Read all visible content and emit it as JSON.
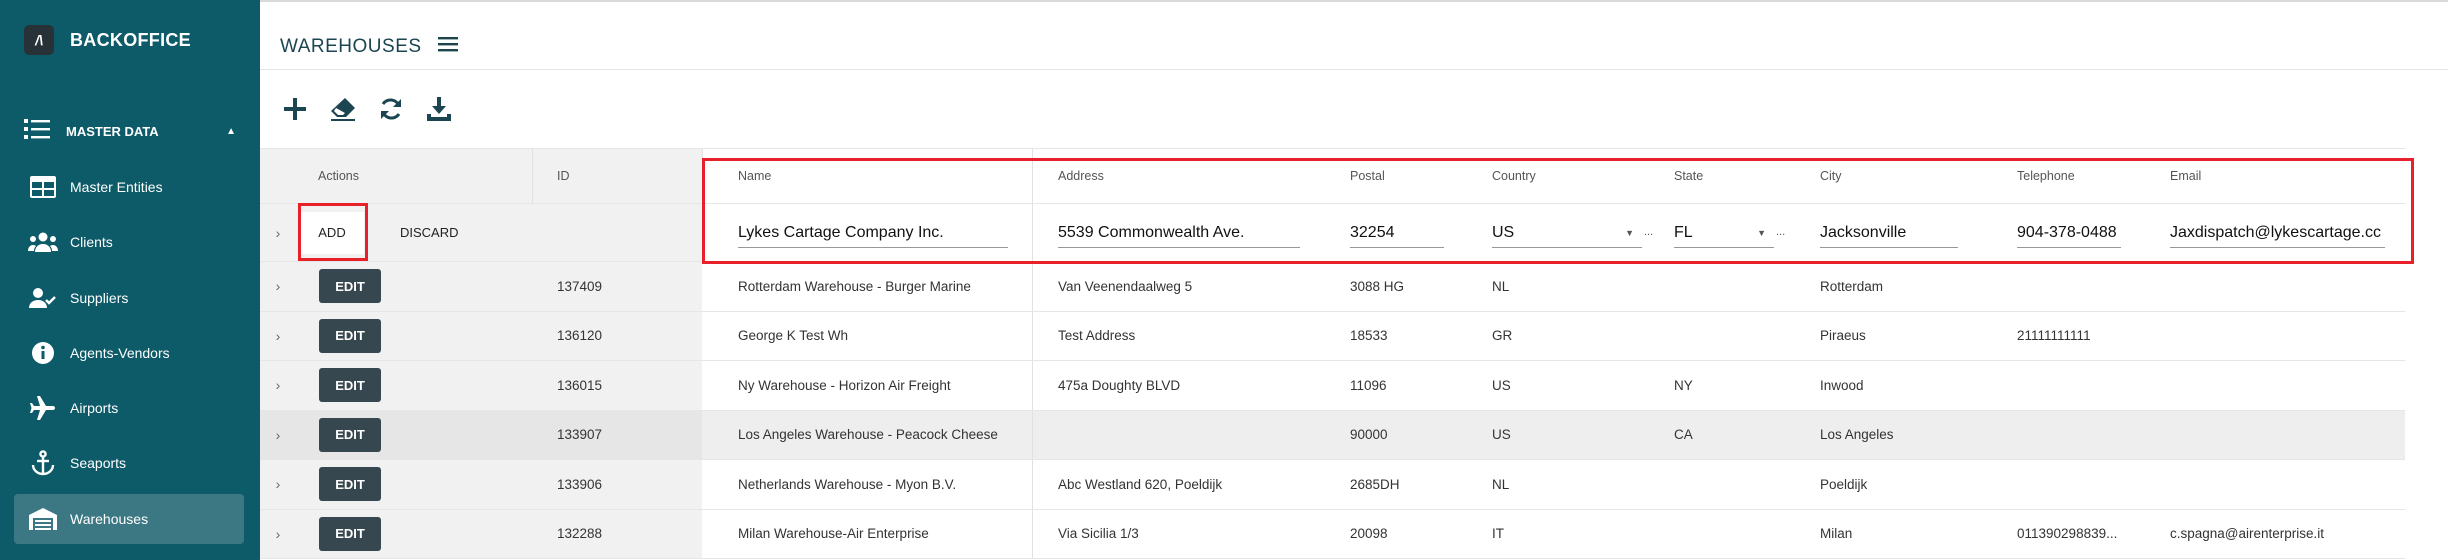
{
  "app": {
    "brand": "BACKOFFICE",
    "logo_glyph": "/\\"
  },
  "sidebar": {
    "group": {
      "label": "MASTER DATA",
      "icon": "list-icon"
    },
    "items": [
      {
        "label": "Master Entities",
        "icon": "table-icon"
      },
      {
        "label": "Clients",
        "icon": "people-icon"
      },
      {
        "label": "Suppliers",
        "icon": "user-check-icon"
      },
      {
        "label": "Agents-Vendors",
        "icon": "info-icon"
      },
      {
        "label": "Airports",
        "icon": "airplane-icon"
      },
      {
        "label": "Seaports",
        "icon": "anchor-icon"
      },
      {
        "label": "Warehouses",
        "icon": "warehouse-icon",
        "active": true
      }
    ]
  },
  "header": {
    "title": "WAREHOUSES"
  },
  "toolbar": {
    "add": "plus-icon",
    "clear": "eraser-icon",
    "refresh": "refresh-icon",
    "download": "download-icon"
  },
  "table": {
    "columns": {
      "actions": "Actions",
      "id": "ID",
      "name": "Name",
      "address": "Address",
      "postal": "Postal",
      "country": "Country",
      "state": "State",
      "city": "City",
      "telephone": "Telephone",
      "email": "Email"
    },
    "new_row": {
      "add_label": "ADD",
      "discard_label": "DISCARD",
      "name": "Lykes Cartage Company Inc.",
      "address": "5539 Commonwealth Ave.",
      "postal": "32254",
      "country": "US",
      "state": "FL",
      "city": "Jacksonville",
      "telephone": "904-378-0488",
      "email": "Jaxdispatch@lykescartage.cc",
      "select_dots": "..."
    },
    "edit_label": "EDIT",
    "rows": [
      {
        "id": "137409",
        "name": "Rotterdam Warehouse - Burger Marine",
        "address": "Van Veenendaalweg 5",
        "postal": "3088 HG",
        "country": "NL",
        "state": "",
        "city": "Rotterdam",
        "telephone": "",
        "email": ""
      },
      {
        "id": "136120",
        "name": "George K Test Wh",
        "address": "Test Address",
        "postal": "18533",
        "country": "GR",
        "state": "",
        "city": "Piraeus",
        "telephone": "21111111111",
        "email": ""
      },
      {
        "id": "136015",
        "name": "Ny Warehouse - Horizon Air Freight",
        "address": "475a Doughty BLVD",
        "postal": "11096",
        "country": "US",
        "state": "NY",
        "city": "Inwood",
        "telephone": "",
        "email": ""
      },
      {
        "id": "133907",
        "name": "Los Angeles Warehouse - Peacock Cheese",
        "address": "",
        "postal": "90000",
        "country": "US",
        "state": "CA",
        "city": "Los Angeles",
        "telephone": "",
        "email": ""
      },
      {
        "id": "133906",
        "name": "Netherlands Warehouse - Myon B.V.",
        "address": "Abc Westland 620, Poeldijk",
        "postal": "2685DH",
        "country": "NL",
        "state": "",
        "city": "Poeldijk",
        "telephone": "",
        "email": ""
      },
      {
        "id": "132288",
        "name": "Milan Warehouse-Air Enterprise",
        "address": "Via Sicilia 1/3",
        "postal": "20098",
        "country": "IT",
        "state": "",
        "city": "Milan",
        "telephone": "011390298839...",
        "email": "c.spagna@airenterprise.it"
      }
    ]
  },
  "colors": {
    "sidebar": "#0d5a68",
    "sidebar_active": "#3c7884",
    "edit_button": "#37474f",
    "highlight": "#e8202a",
    "title": "#1c4552"
  }
}
